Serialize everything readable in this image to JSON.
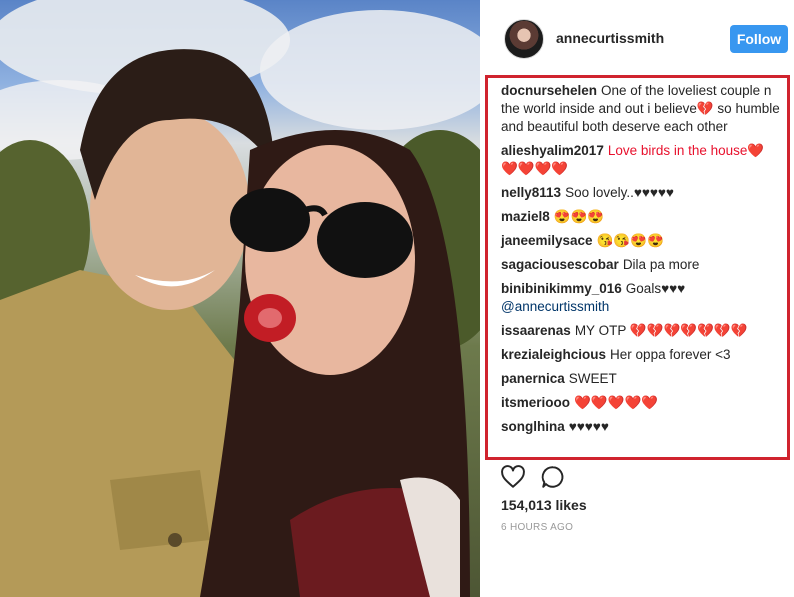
{
  "header": {
    "username": "annecurtissmith",
    "follow_label": "Follow"
  },
  "comments": [
    {
      "user": "docnursehelen",
      "text": "One of the loveliest couple n the world inside and out i believe💔 so humble and beautiful both deserve each other"
    },
    {
      "user": "alieshyalim2017",
      "text": "Love birds in the house❤️ ❤️❤️❤️❤️"
    },
    {
      "user": "nelly8113",
      "text": "Soo lovely..♥♥♥♥♥"
    },
    {
      "user": "maziel8",
      "text": "😍😍😍"
    },
    {
      "user": "janeemilysace",
      "text": "😘😘😍😍"
    },
    {
      "user": "sagaciousescobar",
      "text": "Dila pa more"
    },
    {
      "user": "binibinikimmy_016",
      "text": "Goals♥♥♥",
      "mention": "@annecurtissmith"
    },
    {
      "user": "issaarenas",
      "text": "MY OTP 💔💔💔💔💔💔💔"
    },
    {
      "user": "krezialeighcious",
      "text": "Her oppa forever <3"
    },
    {
      "user": "panernica",
      "text": "SWEET"
    },
    {
      "user": "itsmeriooo",
      "text": "❤️❤️❤️❤️❤️"
    },
    {
      "user": "songlhina",
      "text": "♥♥♥♥♥"
    }
  ],
  "actions": {
    "like_icon": "heart-outline-icon",
    "comment_icon": "comment-bubble-icon"
  },
  "likes": "154,013 likes",
  "timestamp": "6 HOURS AGO",
  "colors": {
    "follow": "#3897f0",
    "highlight_border": "#d0232e",
    "text": "#262626",
    "muted": "#999999"
  }
}
